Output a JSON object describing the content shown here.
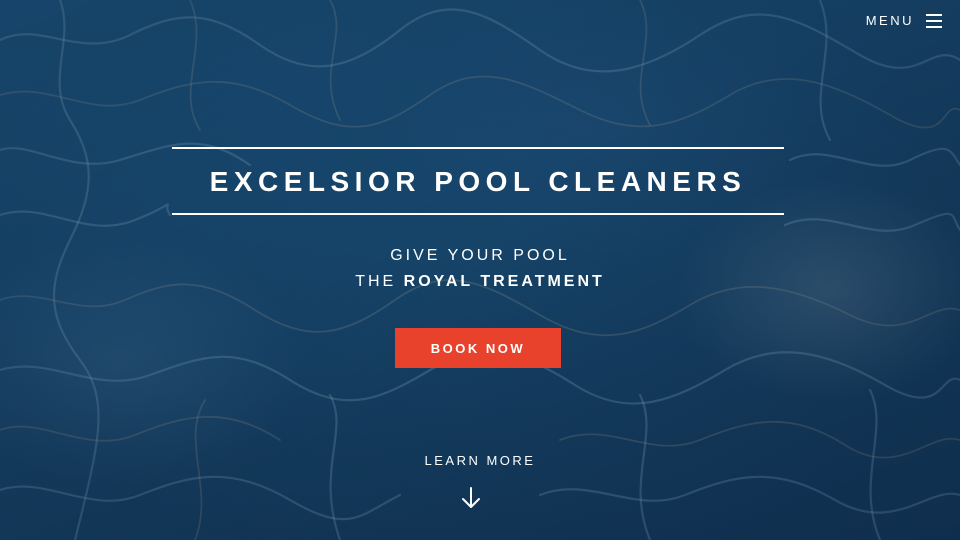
{
  "header": {
    "menu_label": "MENU",
    "menu_icon": "hamburger-icon"
  },
  "hero": {
    "title": "EXCELSIOR POOL CLEANERS",
    "tagline_line1": "GIVE YOUR POOL",
    "tagline_line2_prefix": "THE",
    "tagline_line2_emphasis": "ROYAL TREATMENT",
    "cta_label": "BOOK NOW",
    "learn_more_label": "LEARN MORE",
    "learn_more_icon": "arrow-down-icon",
    "background": "pool-water-image"
  },
  "colors": {
    "accent": "#e8412c",
    "text": "#ffffff",
    "water_dark": "#12375a",
    "water_light": "#1d5a86"
  }
}
